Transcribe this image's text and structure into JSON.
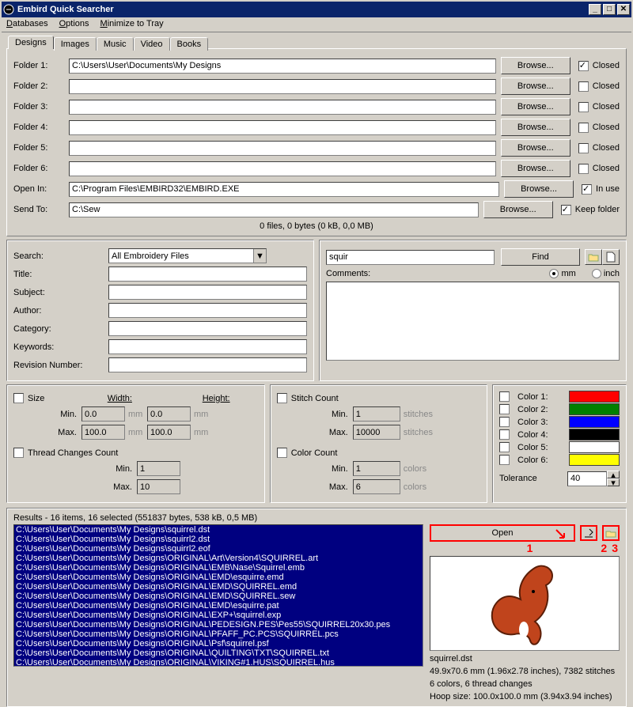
{
  "title": "Embird Quick Searcher",
  "menu": [
    "Databases",
    "Options",
    "Minimize to Tray"
  ],
  "tabs": [
    "Designs",
    "Images",
    "Music",
    "Video",
    "Books"
  ],
  "folders": {
    "labels": [
      "Folder 1:",
      "Folder 2:",
      "Folder 3:",
      "Folder 4:",
      "Folder 5:",
      "Folder 6:"
    ],
    "values": [
      "C:\\Users\\User\\Documents\\My Designs",
      "",
      "",
      "",
      "",
      ""
    ],
    "browse": "Browse...",
    "closed_label": "Closed",
    "closed_states": [
      true,
      false,
      false,
      false,
      false,
      false
    ],
    "open_in_label": "Open In:",
    "open_in_value": "C:\\Program Files\\EMBIRD32\\EMBIRD.EXE",
    "open_in_chk_label": "In use",
    "open_in_chk": true,
    "send_to_label": "Send To:",
    "send_to_value": "C:\\Sew",
    "keep_label": "Keep folder",
    "keep_chk": true,
    "status": "0 files, 0 bytes (0 kB, 0,0 MB)"
  },
  "search": {
    "search_label": "Search:",
    "filetype": "All Embroidery Files",
    "query": "squir",
    "find_btn": "Find",
    "title_label": "Title:",
    "comments_label": "Comments:",
    "unit_mm": "mm",
    "unit_inch": "inch",
    "unit_sel": "mm",
    "subject_label": "Subject:",
    "author_label": "Author:",
    "category_label": "Category:",
    "keywords_label": "Keywords:",
    "revision_label": "Revision Number:"
  },
  "size": {
    "chk_label": "Size",
    "width_label": "Width:",
    "height_label": "Height:",
    "min_label": "Min.",
    "max_label": "Max.",
    "wmin": "0.0",
    "wmax": "100.0",
    "hmin": "0.0",
    "hmax": "100.0",
    "unit": "mm"
  },
  "stitch": {
    "chk_label": "Stitch Count",
    "min_label": "Min.",
    "max_label": "Max.",
    "min": "1",
    "max": "10000",
    "unit": "stitches"
  },
  "thread": {
    "chk_label": "Thread Changes Count",
    "min_label": "Min.",
    "max_label": "Max.",
    "min": "1",
    "max": "10"
  },
  "colorcount": {
    "chk_label": "Color Count",
    "min_label": "Min.",
    "max_label": "Max.",
    "min": "1",
    "max": "6",
    "unit": "colors"
  },
  "colors": {
    "labels": [
      "Color 1:",
      "Color 2:",
      "Color 3:",
      "Color 4:",
      "Color 5:",
      "Color 6:"
    ],
    "hex": [
      "#ff0000",
      "#008000",
      "#0000ff",
      "#000000",
      "#ffffff",
      "#ffff00"
    ],
    "tolerance_label": "Tolerance",
    "tolerance": "40"
  },
  "results": {
    "header": "Results - 16 items, 16 selected (551837 bytes, 538 kB, 0,5 MB)",
    "items": [
      "C:\\Users\\User\\Documents\\My Designs\\squirrel.dst",
      "C:\\Users\\User\\Documents\\My Designs\\squirrl2.dst",
      "C:\\Users\\User\\Documents\\My Designs\\squirrl2.eof",
      "C:\\Users\\User\\Documents\\My Designs\\ORIGINAL\\Art\\Version4\\SQUIRREL.art",
      "C:\\Users\\User\\Documents\\My Designs\\ORIGINAL\\EMB\\Nase\\Squirrel.emb",
      "C:\\Users\\User\\Documents\\My Designs\\ORIGINAL\\EMD\\esquirre.emd",
      "C:\\Users\\User\\Documents\\My Designs\\ORIGINAL\\EMD\\SQUIRREL.emd",
      "C:\\Users\\User\\Documents\\My Designs\\ORIGINAL\\EMD\\SQUIRREL.sew",
      "C:\\Users\\User\\Documents\\My Designs\\ORIGINAL\\EMD\\esquirre.pat",
      "C:\\Users\\User\\Documents\\My Designs\\ORIGINAL\\EXP+\\squirrel.exp",
      "C:\\Users\\User\\Documents\\My Designs\\ORIGINAL\\PEDESIGN.PES\\Pes55\\SQUIRREL20x30.pes",
      "C:\\Users\\User\\Documents\\My Designs\\ORIGINAL\\PFAFF_PC.PCS\\SQUIRREL.pcs",
      "C:\\Users\\User\\Documents\\My Designs\\ORIGINAL\\Psf\\squirrel.psf",
      "C:\\Users\\User\\Documents\\My Designs\\ORIGINAL\\QUILTING\\TXT\\SQUIRREL.txt",
      "C:\\Users\\User\\Documents\\My Designs\\ORIGINAL\\VIKING#1.HUS\\SQUIRREL.hus"
    ],
    "open_btn": "Open",
    "callouts": [
      "1",
      "2",
      "3"
    ],
    "preview_name": "squirrel.dst",
    "preview_dim": "49.9x70.6 mm (1.96x2.78 inches), 7382 stitches",
    "preview_colors": "6 colors, 6 thread changes",
    "preview_hoop": "Hoop size: 100.0x100.0 mm (3.94x3.94 inches)"
  }
}
